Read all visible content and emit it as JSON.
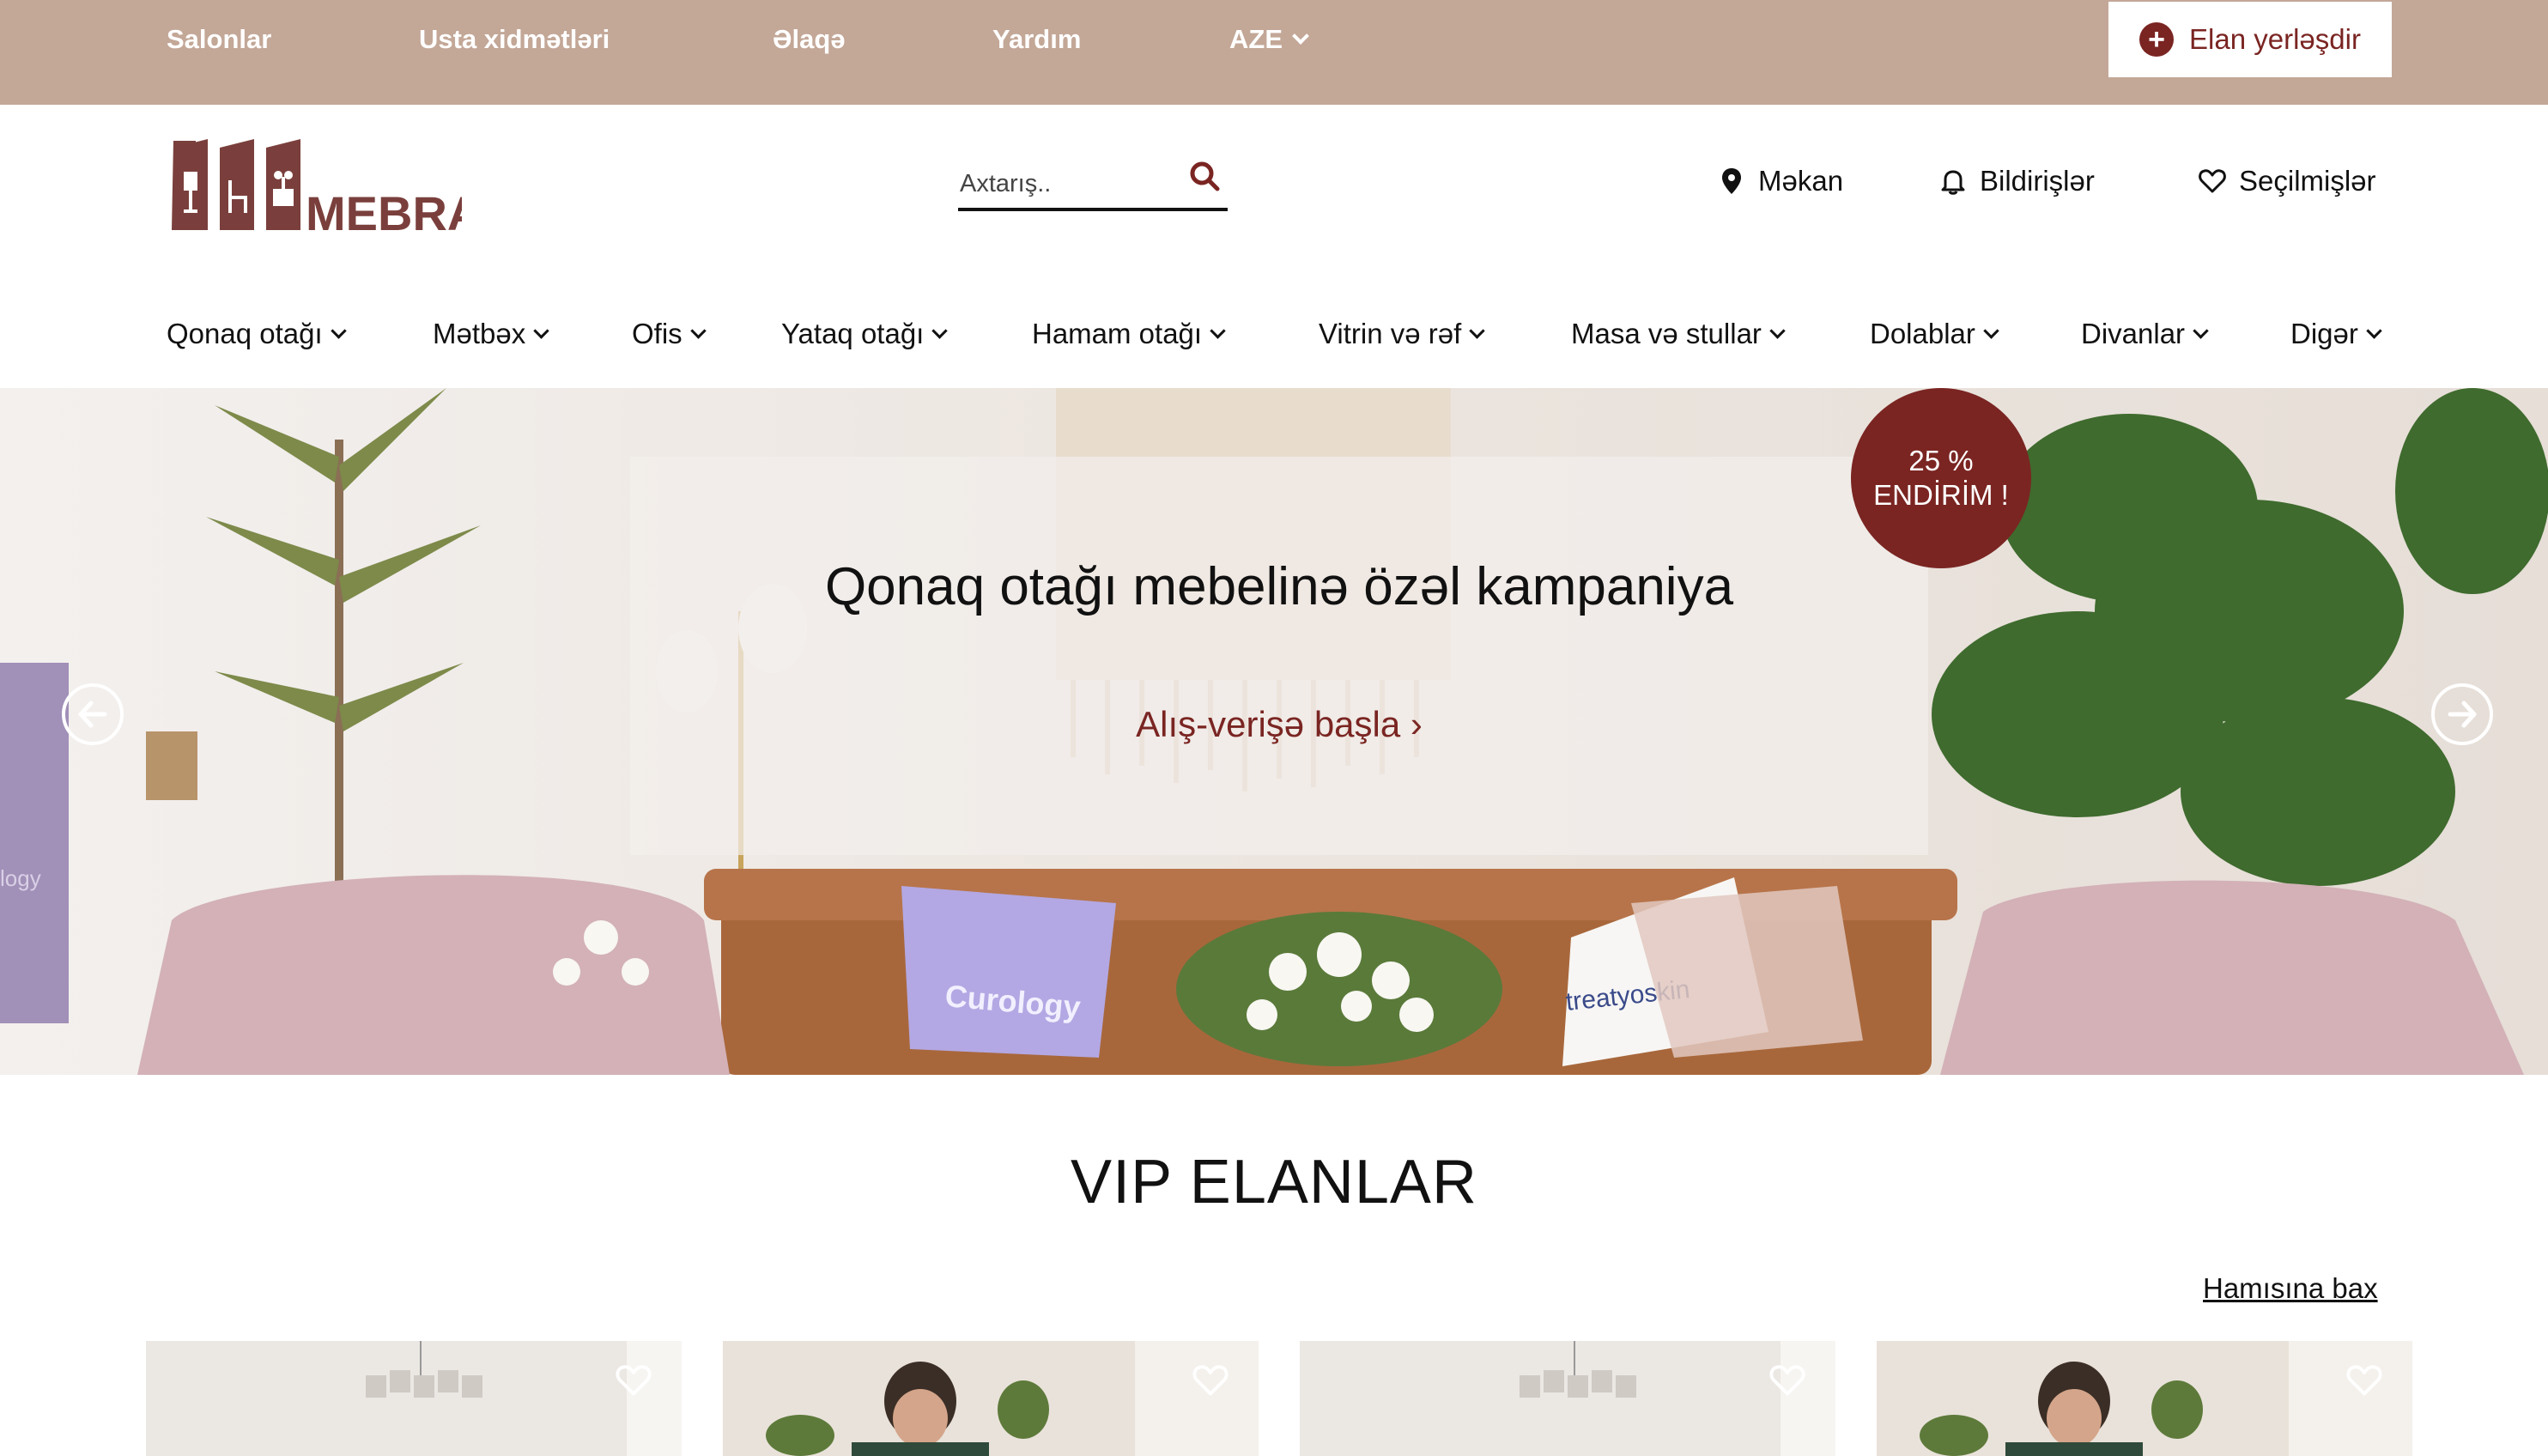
{
  "topbar": {
    "links": [
      "Salonlar",
      "Usta xidmətləri",
      "Əlaqə",
      "Yardım"
    ],
    "language": "AZE",
    "post_button": "Elan yerləşdir"
  },
  "header": {
    "logo_text": "MEBRA",
    "search_placeholder": "Axtarış..",
    "location": "Məkan",
    "notifications": "Bildirişlər",
    "favorites": "Seçilmişlər"
  },
  "categories": [
    "Qonaq otağı",
    "Mətbəx",
    "Ofis",
    "Yataq otağı",
    "Hamam otağı",
    "Vitrin və rəf",
    "Masa və stullar",
    "Dolablar",
    "Divanlar",
    "Digər"
  ],
  "hero": {
    "title": "Qonaq otağı mebelinə özəl kampaniya",
    "cta": "Alış-verişə başla ›",
    "badge_line1": "25 %",
    "badge_line2": "ENDİRİM !",
    "pillow_text_1": "Curology",
    "pillow_text_2": "treatyoskin",
    "towel_text": "logy"
  },
  "vip": {
    "title": "VIP ELANLAR",
    "see_all": "Hamısına bax"
  },
  "colors": {
    "topbar": "#c3a797",
    "accent": "#7a2522",
    "text": "#111111"
  }
}
